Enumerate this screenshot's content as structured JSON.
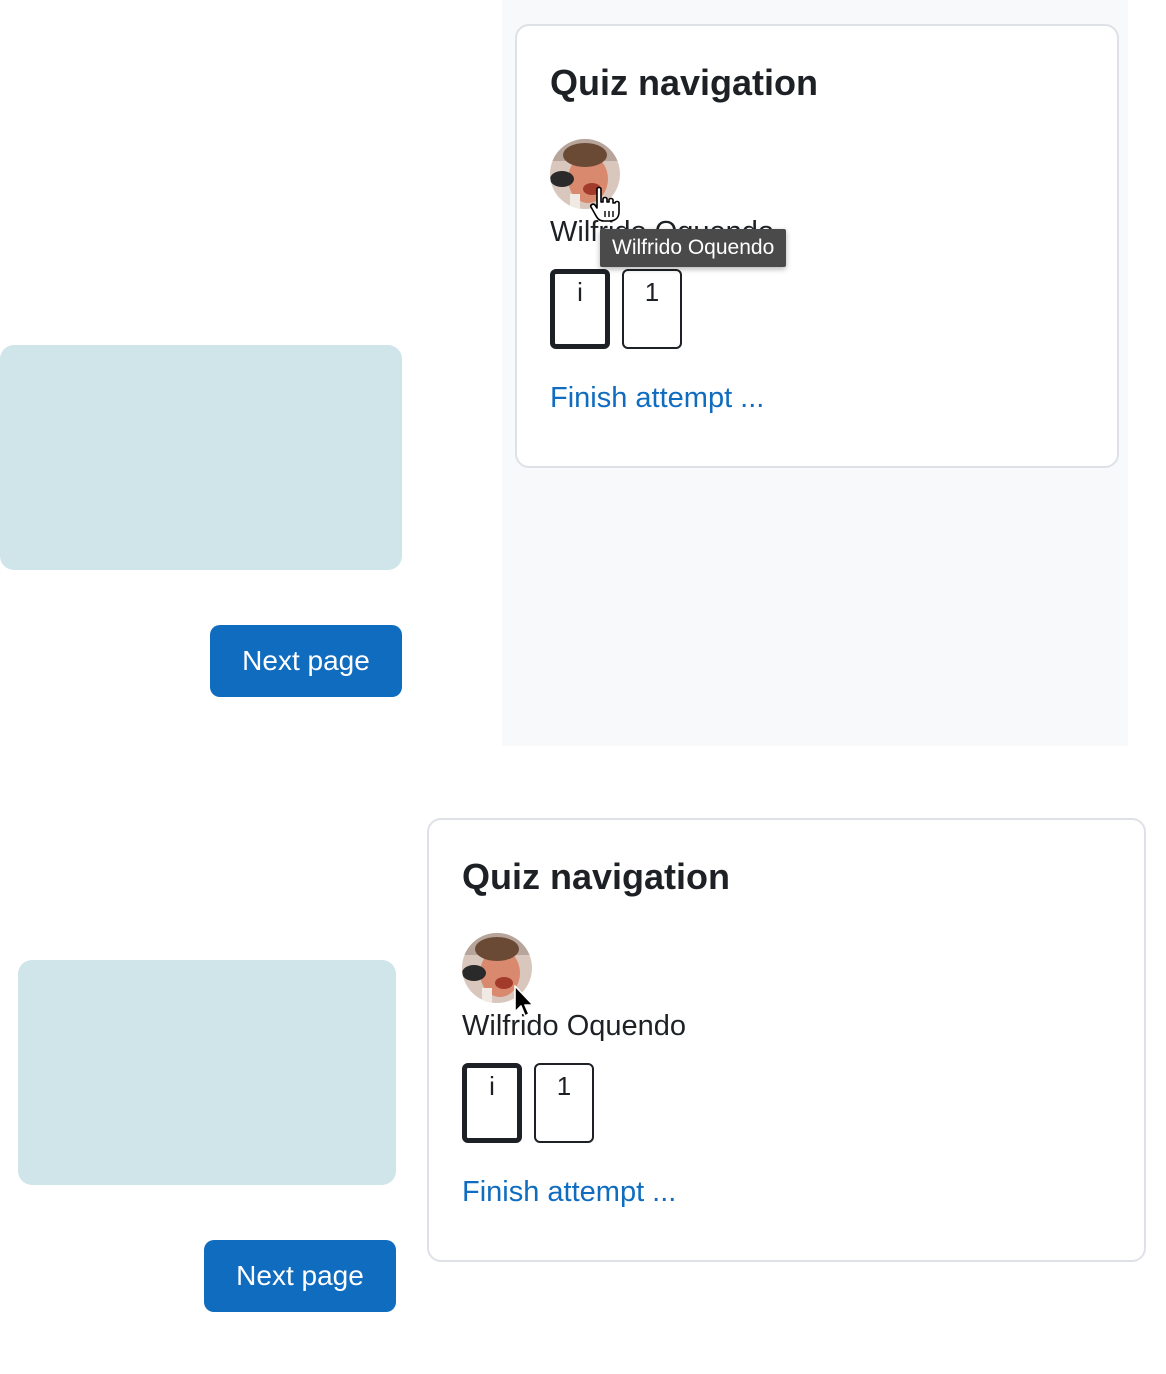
{
  "top_view": {
    "quiz_nav": {
      "title": "Quiz navigation",
      "user_name": "Wilfrido Oquendo",
      "tooltip": "Wilfrido Oquendo",
      "buttons": [
        {
          "label": "i",
          "state": "current"
        },
        {
          "label": "1",
          "state": "normal"
        }
      ],
      "finish_link": "Finish attempt ..."
    },
    "next_page_label": "Next page",
    "cursor": "hand-pointer-icon"
  },
  "bottom_view": {
    "quiz_nav": {
      "title": "Quiz navigation",
      "user_name": "Wilfrido Oquendo",
      "buttons": [
        {
          "label": "i",
          "state": "current"
        },
        {
          "label": "1",
          "state": "normal"
        }
      ],
      "finish_link": "Finish attempt ..."
    },
    "next_page_label": "Next page",
    "cursor": "arrow-pointer-icon"
  },
  "colors": {
    "link": "#0f6cbf",
    "button_bg": "#0f6cbf",
    "info_box": "#cfe5e9",
    "drawer_bg": "#f8f9fa",
    "card_border": "#dee2e6",
    "tooltip_bg": "#4a4a4a"
  }
}
